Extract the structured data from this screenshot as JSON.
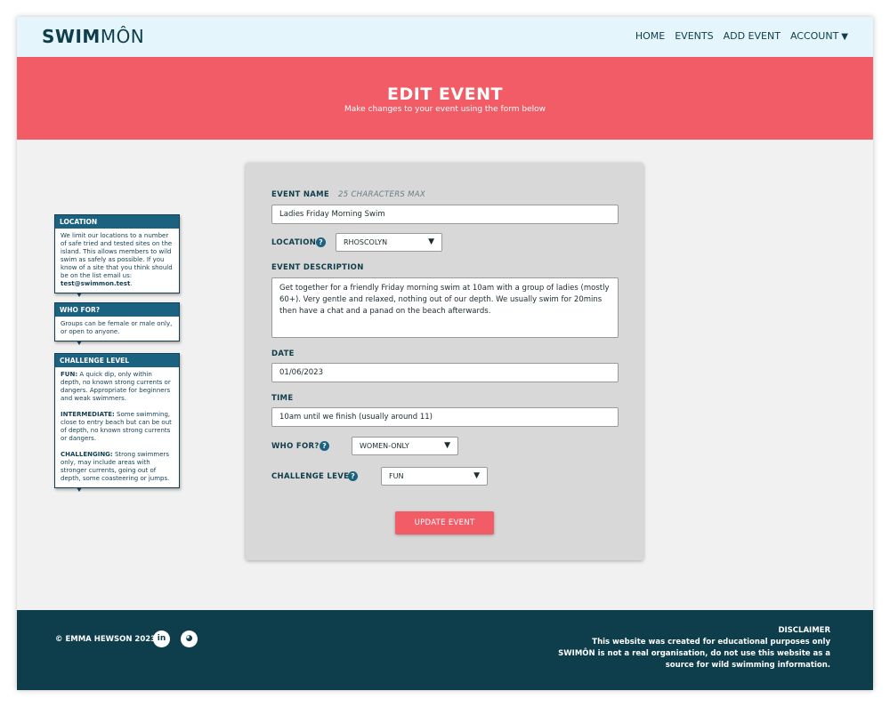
{
  "brand": {
    "logo_bold": "SWIM",
    "logo_light": "MÔN"
  },
  "nav": {
    "home": "HOME",
    "events": "EVENTS",
    "add_event": "ADD EVENT",
    "account": "ACCOUNT",
    "account_caret": "▼"
  },
  "hero": {
    "title": "EDIT EVENT",
    "subtitle": "Make changes to your event using the form below"
  },
  "sidebar": {
    "location": {
      "title": "LOCATION",
      "body": "We limit our locations to a number of safe tried and tested sites on the island. This allows members to wild swim as safely as possible. If you know of a site that you think should be on the list email us: ",
      "email": "test@swimmon.test",
      "end": "."
    },
    "who_for": {
      "title": "WHO FOR?",
      "body": "Groups can be female or male only, or open to anyone."
    },
    "challenge": {
      "title": "CHALLENGE LEVEL",
      "fun_label": "FUN:",
      "fun_text": " A quick dip, only within depth, no known strong currents or dangers. Appropriate for beginners and weak swimmers.",
      "intermediate_label": "INTERMEDIATE:",
      "intermediate_text": " Some swimming, close to entry beach but can be out of depth, no known strong currents or dangers.",
      "challenging_label": "CHALLENGING:",
      "challenging_text": " Strong swimmers only, may include areas with stronger currents, going out of depth, some coasteering or jumps."
    }
  },
  "form": {
    "event_name_label": "EVENT NAME",
    "event_name_hint": "25 CHARACTERS MAX",
    "event_name_value": "Ladies Friday Morning Swim",
    "location_label": "LOCATION",
    "location_value": "RHOSCOLYN",
    "description_label": "EVENT DESCRIPTION",
    "description_value": "Get together for a friendly Friday morning swim at 10am with a group of ladies (mostly 60+). Very gentle and relaxed, nothing out of our depth. We usually swim for 20mins then have a chat and a panad on the beach afterwards.",
    "date_label": "DATE",
    "date_value": "01/06/2023",
    "time_label": "TIME",
    "time_value": "10am until we finish (usually around 11)",
    "who_for_label": "WHO FOR?",
    "who_for_value": "WOMEN-ONLY",
    "challenge_label": "CHALLENGE LEVEL",
    "challenge_value": "FUN",
    "help_glyph": "?",
    "select_arrow": "▼",
    "submit_label": "UPDATE EVENT"
  },
  "footer": {
    "copyright": "© EMMA HEWSON 2023",
    "linkedin_glyph": "in",
    "github_glyph": "◕",
    "disclaimer_title": "DISCLAIMER",
    "disclaimer_line1": "This website was created for educational purposes only",
    "disclaimer_line2": "SWIMÔN is not a real organisation, do not use this website as a",
    "disclaimer_line3": "source for wild swimming information."
  },
  "colors": {
    "primary_dark": "#0e3d4b",
    "accent_red": "#f25c66",
    "info_header": "#1b6180",
    "nav_bg": "#e4f5fb"
  }
}
